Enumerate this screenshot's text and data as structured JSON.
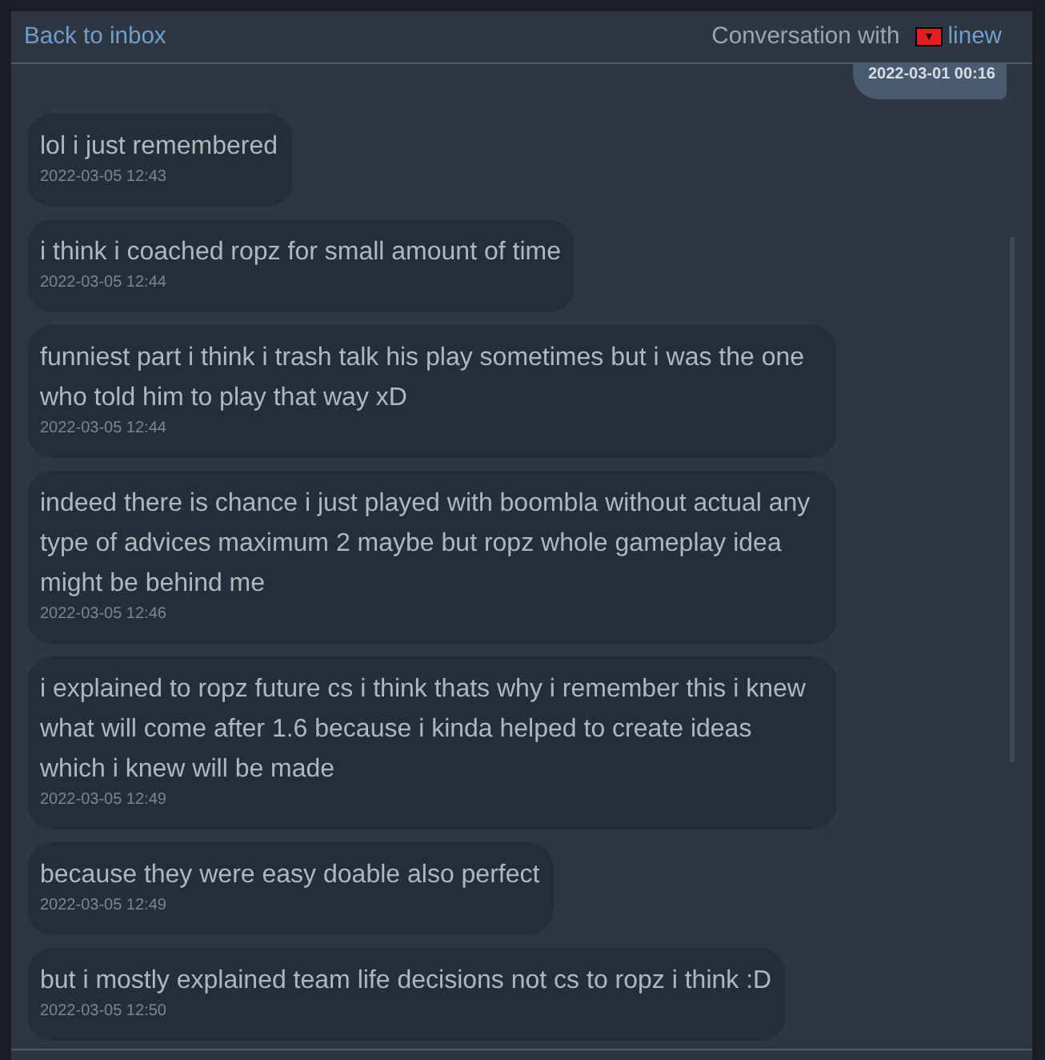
{
  "header": {
    "back_link": "Back to inbox",
    "title_prefix": "Conversation with",
    "user": {
      "name": "linew"
    }
  },
  "messages": [
    {
      "kind": "sent",
      "time": "2022-03-01 00:16"
    },
    {
      "kind": "received",
      "text": "lol i just remembered",
      "time": "2022-03-05 12:43"
    },
    {
      "kind": "received",
      "text": "i think i coached ropz for small amount of time",
      "time": "2022-03-05 12:44"
    },
    {
      "kind": "received",
      "text": "funniest part i think i trash talk his play sometimes but i was the one who told him to play that way xD",
      "time": "2022-03-05 12:44"
    },
    {
      "kind": "received",
      "text": "indeed there is chance i just played with boombla without actual any type of advices maximum 2 maybe but ropz whole gameplay idea might be behind me",
      "time": "2022-03-05 12:46"
    },
    {
      "kind": "received",
      "text": "i explained to ropz future cs i think thats why i remember this i knew what will come after 1.6 because i kinda helped to create ideas which i knew will be made",
      "time": "2022-03-05 12:49"
    },
    {
      "kind": "received",
      "text": "because they were easy doable also perfect",
      "time": "2022-03-05 12:49"
    },
    {
      "kind": "received",
      "text": "but i mostly explained team life decisions not cs to ropz i think :D",
      "time": "2022-03-05 12:50"
    }
  ]
}
